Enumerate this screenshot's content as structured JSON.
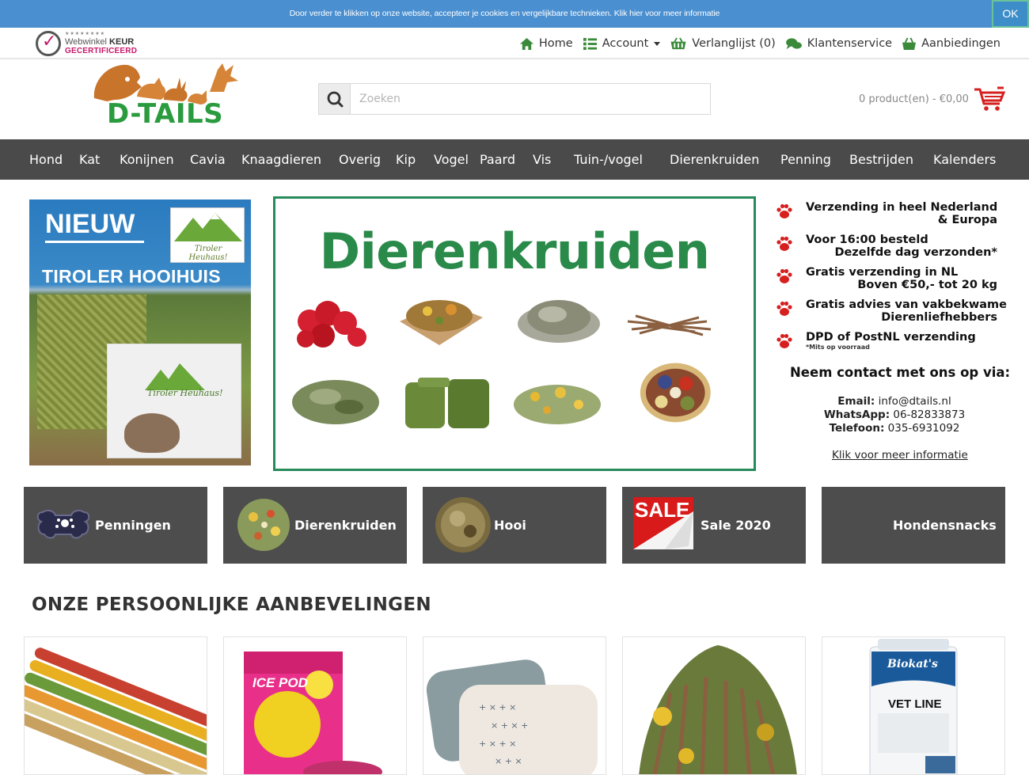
{
  "cookie_bar": {
    "text": "Door verder te klikken op onze website, accepteer je cookies en vergelijkbare technieken. Klik hier voor meer informatie",
    "ok_label": "OK"
  },
  "certificate": {
    "stars": "★★★★★★★★",
    "line1_prefix": "Webwinkel ",
    "line1_bold": "KEUR",
    "line2": "GECERTIFICEERD"
  },
  "top_nav": {
    "home": "Home",
    "account": "Account",
    "wishlist": "Verlanglijst (0)",
    "service": "Klantenservice",
    "offers": "Aanbiedingen"
  },
  "logo": {
    "text": "D-TAILS"
  },
  "search": {
    "placeholder": "Zoeken"
  },
  "cart": {
    "summary": "0 product(en) - €0,00"
  },
  "main_nav": [
    "Hond",
    "Kat",
    "Konijnen",
    "Cavia",
    "Knaagdieren",
    "Overig",
    "Kip",
    "Vogel",
    "Paard",
    "Vis",
    "Tuin-/vogel",
    "Dierenkruiden",
    "Penning",
    "Bestrijden",
    "Kalenders"
  ],
  "promo_left": {
    "heading": "NIEUW",
    "subheading": "TIROLER HOOIHUIS",
    "badge": "Tiroler Heuhaus!",
    "box_label": "Tiroler Heuhaus!"
  },
  "promo_main": {
    "title": "Dierenkruiden"
  },
  "usps": [
    {
      "line1": "Verzending in heel Nederland",
      "line2": "& Europa",
      "note": ""
    },
    {
      "line1": "Voor 16:00 besteld",
      "line2": "Dezelfde dag verzonden*",
      "note": ""
    },
    {
      "line1": "Gratis verzending in NL",
      "line2": "Boven €50,- tot 20 kg",
      "note": ""
    },
    {
      "line1": "Gratis advies van vakbekwame",
      "line2": "Dierenliefhebbers",
      "note": ""
    },
    {
      "line1": "DPD of PostNL verzending",
      "line2": "",
      "note": "*Mits op voorraad"
    }
  ],
  "contact": {
    "title": "Neem contact met ons op via:",
    "email_label": "Email:",
    "email": "info@dtails.nl",
    "whatsapp_label": "WhatsApp:",
    "whatsapp": "06-82833873",
    "phone_label": "Telefoon:",
    "phone": "035-6931092",
    "more_link": "Klik voor meer informatie"
  },
  "tiles": [
    {
      "label": "Penningen"
    },
    {
      "label": "Dierenkruiden"
    },
    {
      "label": "Hooi"
    },
    {
      "label": "Sale 2020",
      "image_text": "SALE"
    },
    {
      "label": "Hondensnacks"
    }
  ],
  "recommendations": {
    "title": "ONZE PERSOONLIJKE AANBEVELINGEN",
    "products": [
      {
        "name": "sticks"
      },
      {
        "name": "ice-pod",
        "packaging_text": "ICE POD"
      },
      {
        "name": "cushion"
      },
      {
        "name": "herbs-mix"
      },
      {
        "name": "biokats-vet-line",
        "packaging_brand": "Biokat's",
        "packaging_text": "VET LINE"
      }
    ]
  },
  "colors": {
    "cookie_bar": "#4a8fd0",
    "nav_bg": "#4a4a4a",
    "tile_bg": "#4d4d4d",
    "brand_green": "#2a9b3e",
    "brand_orange": "#c8742a",
    "paw_red": "#d62020"
  }
}
